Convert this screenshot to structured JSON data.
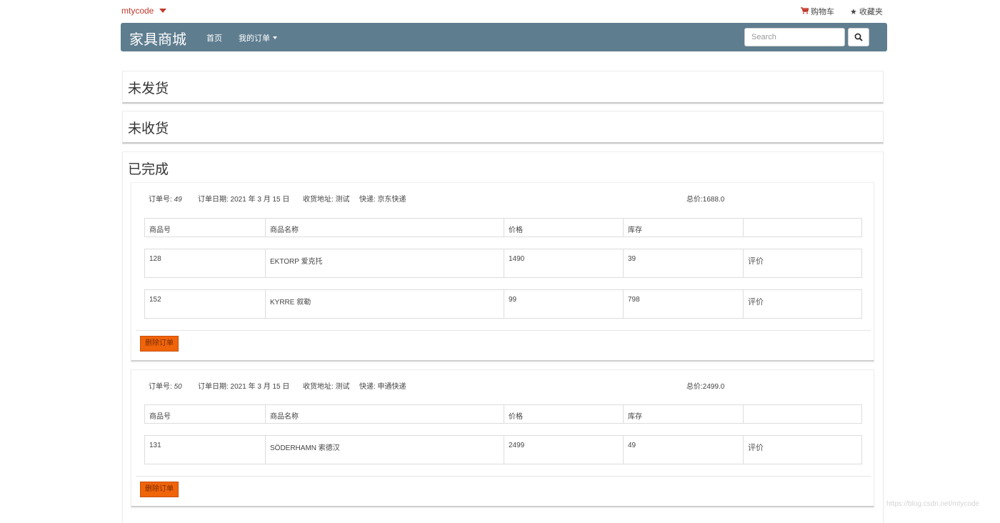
{
  "topbar": {
    "username": "mtycode",
    "cart_label": "购物车",
    "favorites_label": "收藏夹"
  },
  "navbar": {
    "brand": "家具商城",
    "home_label": "首页",
    "my_orders_label": "我的订单",
    "search_placeholder": "Search",
    "search_value": "",
    "color": "#5e7d8f"
  },
  "sections": {
    "unshipped": "未发货",
    "unreceived": "未收货",
    "completed": "已完成"
  },
  "table_headers": [
    "商品号",
    "商品名称",
    "价格",
    "库存",
    ""
  ],
  "orders": [
    {
      "no_label": "订单号:",
      "no": "49",
      "date": "订单日期: 2021 年 3 月 15 日",
      "address": "收货地址: 测试",
      "express": "快递: 京东快递",
      "total": "总价:1688.0",
      "items": [
        {
          "id": "128",
          "name": "EKTORP 爱克托",
          "price": "1490",
          "stock": "39",
          "action": "评价"
        },
        {
          "id": "152",
          "name": "KYRRE 叙勒",
          "price": "99",
          "stock": "798",
          "action": "评价"
        }
      ],
      "delete_label": "删除订单"
    },
    {
      "no_label": "订单号:",
      "no": "50",
      "date": "订单日期: 2021 年 3 月 15 日",
      "address": "收货地址: 测试",
      "express": "快递: 申通快递",
      "total": "总价:2499.0",
      "items": [
        {
          "id": "131",
          "name": "SÖDERHAMN 索德汉",
          "price": "2499",
          "stock": "49",
          "action": "评价"
        }
      ],
      "delete_label": "删除订单"
    }
  ],
  "watermark": "https://blog.csdn.net/mtycode",
  "colors": {
    "accent_red": "#c0392b",
    "delete_button": "#f0640a"
  }
}
